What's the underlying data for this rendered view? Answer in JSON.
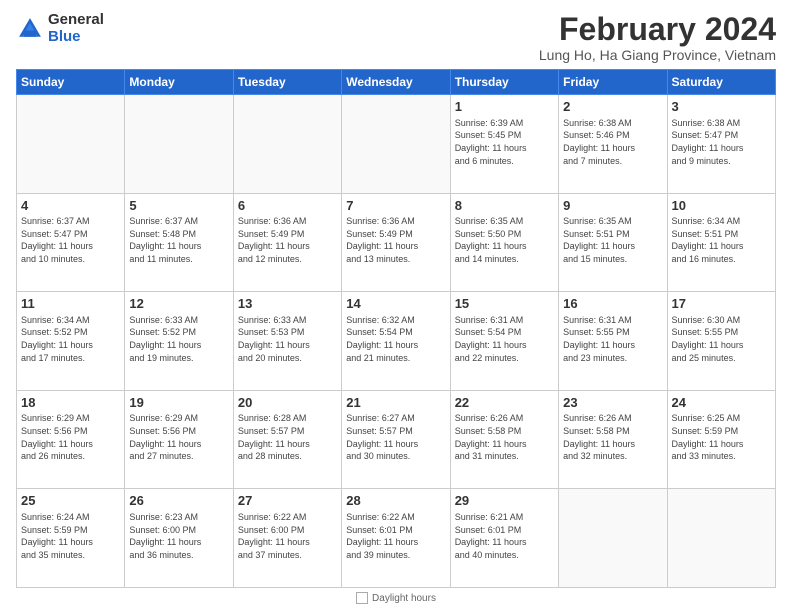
{
  "header": {
    "logo_general": "General",
    "logo_blue": "Blue",
    "month": "February 2024",
    "location": "Lung Ho, Ha Giang Province, Vietnam"
  },
  "days_of_week": [
    "Sunday",
    "Monday",
    "Tuesday",
    "Wednesday",
    "Thursday",
    "Friday",
    "Saturday"
  ],
  "weeks": [
    [
      {
        "day": "",
        "info": ""
      },
      {
        "day": "",
        "info": ""
      },
      {
        "day": "",
        "info": ""
      },
      {
        "day": "",
        "info": ""
      },
      {
        "day": "1",
        "info": "Sunrise: 6:39 AM\nSunset: 5:45 PM\nDaylight: 11 hours\nand 6 minutes."
      },
      {
        "day": "2",
        "info": "Sunrise: 6:38 AM\nSunset: 5:46 PM\nDaylight: 11 hours\nand 7 minutes."
      },
      {
        "day": "3",
        "info": "Sunrise: 6:38 AM\nSunset: 5:47 PM\nDaylight: 11 hours\nand 9 minutes."
      }
    ],
    [
      {
        "day": "4",
        "info": "Sunrise: 6:37 AM\nSunset: 5:47 PM\nDaylight: 11 hours\nand 10 minutes."
      },
      {
        "day": "5",
        "info": "Sunrise: 6:37 AM\nSunset: 5:48 PM\nDaylight: 11 hours\nand 11 minutes."
      },
      {
        "day": "6",
        "info": "Sunrise: 6:36 AM\nSunset: 5:49 PM\nDaylight: 11 hours\nand 12 minutes."
      },
      {
        "day": "7",
        "info": "Sunrise: 6:36 AM\nSunset: 5:49 PM\nDaylight: 11 hours\nand 13 minutes."
      },
      {
        "day": "8",
        "info": "Sunrise: 6:35 AM\nSunset: 5:50 PM\nDaylight: 11 hours\nand 14 minutes."
      },
      {
        "day": "9",
        "info": "Sunrise: 6:35 AM\nSunset: 5:51 PM\nDaylight: 11 hours\nand 15 minutes."
      },
      {
        "day": "10",
        "info": "Sunrise: 6:34 AM\nSunset: 5:51 PM\nDaylight: 11 hours\nand 16 minutes."
      }
    ],
    [
      {
        "day": "11",
        "info": "Sunrise: 6:34 AM\nSunset: 5:52 PM\nDaylight: 11 hours\nand 17 minutes."
      },
      {
        "day": "12",
        "info": "Sunrise: 6:33 AM\nSunset: 5:52 PM\nDaylight: 11 hours\nand 19 minutes."
      },
      {
        "day": "13",
        "info": "Sunrise: 6:33 AM\nSunset: 5:53 PM\nDaylight: 11 hours\nand 20 minutes."
      },
      {
        "day": "14",
        "info": "Sunrise: 6:32 AM\nSunset: 5:54 PM\nDaylight: 11 hours\nand 21 minutes."
      },
      {
        "day": "15",
        "info": "Sunrise: 6:31 AM\nSunset: 5:54 PM\nDaylight: 11 hours\nand 22 minutes."
      },
      {
        "day": "16",
        "info": "Sunrise: 6:31 AM\nSunset: 5:55 PM\nDaylight: 11 hours\nand 23 minutes."
      },
      {
        "day": "17",
        "info": "Sunrise: 6:30 AM\nSunset: 5:55 PM\nDaylight: 11 hours\nand 25 minutes."
      }
    ],
    [
      {
        "day": "18",
        "info": "Sunrise: 6:29 AM\nSunset: 5:56 PM\nDaylight: 11 hours\nand 26 minutes."
      },
      {
        "day": "19",
        "info": "Sunrise: 6:29 AM\nSunset: 5:56 PM\nDaylight: 11 hours\nand 27 minutes."
      },
      {
        "day": "20",
        "info": "Sunrise: 6:28 AM\nSunset: 5:57 PM\nDaylight: 11 hours\nand 28 minutes."
      },
      {
        "day": "21",
        "info": "Sunrise: 6:27 AM\nSunset: 5:57 PM\nDaylight: 11 hours\nand 30 minutes."
      },
      {
        "day": "22",
        "info": "Sunrise: 6:26 AM\nSunset: 5:58 PM\nDaylight: 11 hours\nand 31 minutes."
      },
      {
        "day": "23",
        "info": "Sunrise: 6:26 AM\nSunset: 5:58 PM\nDaylight: 11 hours\nand 32 minutes."
      },
      {
        "day": "24",
        "info": "Sunrise: 6:25 AM\nSunset: 5:59 PM\nDaylight: 11 hours\nand 33 minutes."
      }
    ],
    [
      {
        "day": "25",
        "info": "Sunrise: 6:24 AM\nSunset: 5:59 PM\nDaylight: 11 hours\nand 35 minutes."
      },
      {
        "day": "26",
        "info": "Sunrise: 6:23 AM\nSunset: 6:00 PM\nDaylight: 11 hours\nand 36 minutes."
      },
      {
        "day": "27",
        "info": "Sunrise: 6:22 AM\nSunset: 6:00 PM\nDaylight: 11 hours\nand 37 minutes."
      },
      {
        "day": "28",
        "info": "Sunrise: 6:22 AM\nSunset: 6:01 PM\nDaylight: 11 hours\nand 39 minutes."
      },
      {
        "day": "29",
        "info": "Sunrise: 6:21 AM\nSunset: 6:01 PM\nDaylight: 11 hours\nand 40 minutes."
      },
      {
        "day": "",
        "info": ""
      },
      {
        "day": "",
        "info": ""
      }
    ]
  ],
  "footer": {
    "daylight_label": "Daylight hours"
  }
}
